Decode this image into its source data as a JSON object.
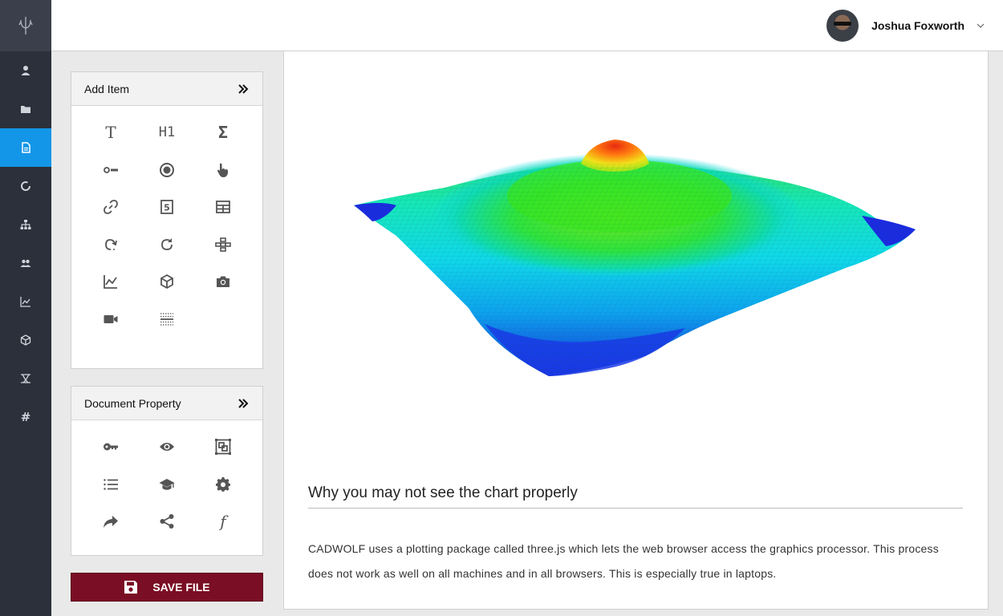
{
  "header": {
    "user_name": "Joshua Foxworth"
  },
  "nav": {
    "items": [
      {
        "icon": "user-icon",
        "active": false
      },
      {
        "icon": "folder-icon",
        "active": false
      },
      {
        "icon": "document-icon",
        "active": true
      },
      {
        "icon": "circle-icon",
        "active": false
      },
      {
        "icon": "sitemap-icon",
        "active": false
      },
      {
        "icon": "users-icon",
        "active": false
      },
      {
        "icon": "chart-icon",
        "active": false
      },
      {
        "icon": "cube-icon",
        "active": false
      },
      {
        "icon": "network-icon",
        "active": false
      },
      {
        "icon": "hash-icon",
        "active": false,
        "glyph": "#"
      }
    ]
  },
  "add_item": {
    "title": "Add Item",
    "tools": [
      {
        "icon": "text-icon",
        "glyph": "T"
      },
      {
        "icon": "heading-icon",
        "glyph": "H1"
      },
      {
        "icon": "sigma-icon",
        "glyph": "Σ"
      },
      {
        "icon": "toggle-icon"
      },
      {
        "icon": "radio-icon"
      },
      {
        "icon": "pointer-icon"
      },
      {
        "icon": "link-icon"
      },
      {
        "icon": "html5-icon",
        "glyph": "5"
      },
      {
        "icon": "table-icon"
      },
      {
        "icon": "redo-icon"
      },
      {
        "icon": "refresh-icon"
      },
      {
        "icon": "blocks-icon"
      },
      {
        "icon": "line-chart-icon"
      },
      {
        "icon": "cube-icon"
      },
      {
        "icon": "camera-icon"
      },
      {
        "icon": "video-icon"
      },
      {
        "icon": "grid-dotted-icon"
      }
    ]
  },
  "document_property": {
    "title": "Document Property",
    "tools": [
      {
        "icon": "key-icon"
      },
      {
        "icon": "eye-icon"
      },
      {
        "icon": "frame-icon"
      },
      {
        "icon": "list-icon"
      },
      {
        "icon": "graduation-cap-icon"
      },
      {
        "icon": "gear-icon"
      },
      {
        "icon": "share-arrow-icon"
      },
      {
        "icon": "share-nodes-icon"
      },
      {
        "icon": "function-icon",
        "glyph": "f"
      }
    ]
  },
  "save_button": {
    "label": "SAVE FILE",
    "icon": "floppy-disk-icon"
  },
  "content": {
    "heading": "Why you may not see the chart properly",
    "paragraph": "CADWOLF uses a plotting package called three.js which lets the web browser access the graphics processor. This process does not work as well on all machines and in all browsers. This is especially true in laptops."
  },
  "colors": {
    "nav_bg": "#2b303b",
    "nav_active": "#1496e8",
    "save_button": "#7a0e24"
  }
}
